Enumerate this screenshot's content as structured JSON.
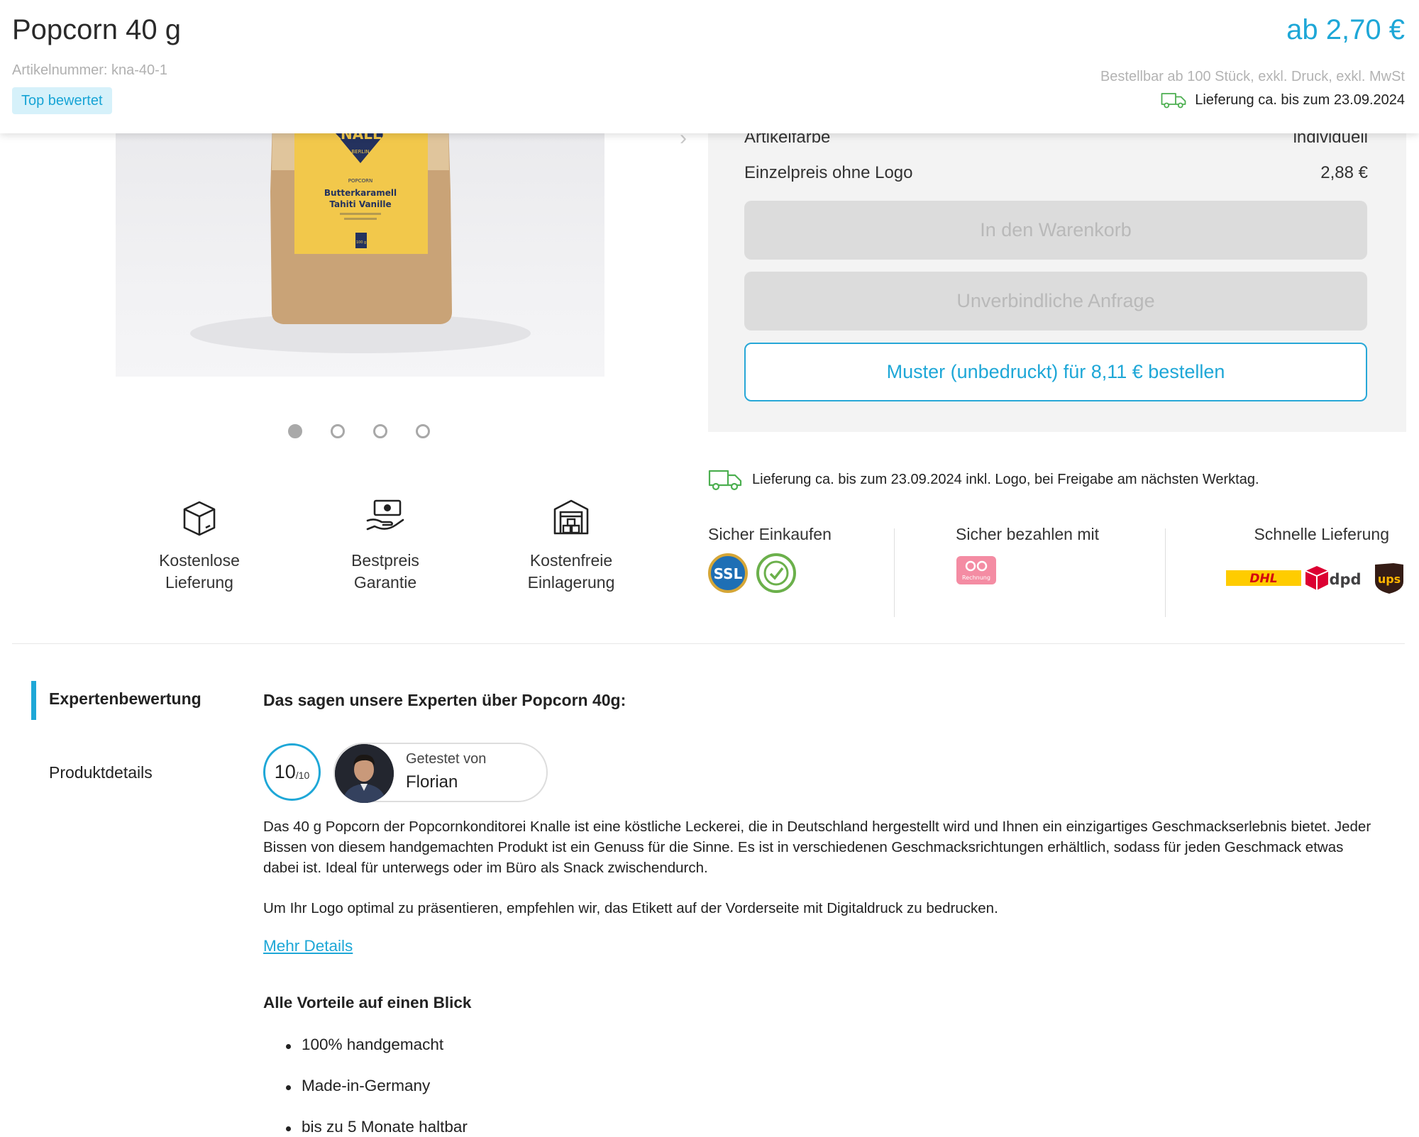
{
  "header": {
    "title": "Popcorn 40 g",
    "article_number": "Artikelnummer: kna-40-1",
    "badge": "Top bewertet",
    "price": "ab 2,70 €",
    "order_min": "Bestellbar ab 100 Stück, exkl. Druck, exkl. MwSt",
    "delivery": "Lieferung ca. bis zum 23.09.2024"
  },
  "product_image": {
    "brand": "KNALLE",
    "city": "BERLIN",
    "category": "POPCORN",
    "flavor_line1": "Butterkaramell",
    "flavor_line2": "Tahiti Vanille",
    "weight": "100 g"
  },
  "gallery": {
    "slide_count": 4,
    "active_index": 0
  },
  "features": [
    {
      "icon": "box-icon",
      "label": "Kostenlose\nLieferung"
    },
    {
      "icon": "money-hand-icon",
      "label": "Bestpreis\nGarantie"
    },
    {
      "icon": "warehouse-icon",
      "label": "Kostenfreie\nEinlagerung"
    }
  ],
  "panel": {
    "color_label": "Artikelfarbe",
    "color_value": "individuell",
    "unit_price_label": "Einzelpreis ohne Logo",
    "unit_price_value": "2,88 €",
    "cart_button": "In den Warenkorb",
    "inquiry_button": "Unverbindliche Anfrage",
    "sample_button": "Muster (unbedruckt) für 8,11 € bestellen"
  },
  "delivery_note": "Lieferung ca. bis zum 23.09.2024 inkl. Logo, bei Freigabe am nächsten Werktag.",
  "trust": {
    "shop_title": "Sicher Einkaufen",
    "ssl_text": "SSL",
    "pay_title": "Sicher bezahlen mit",
    "invoice_text": "Rechnung",
    "ship_title": "Schnelle Lieferung",
    "dhl": "DHL",
    "dpd": "dpd",
    "ups": "ups"
  },
  "tabs": {
    "expert": "Expertenbewertung",
    "details": "Produktdetails"
  },
  "review": {
    "heading": "Das sagen unsere Experten über Popcorn 40g:",
    "score": "10",
    "score_max": "/10",
    "tested_by": "Getestet von",
    "tester_name": "Florian"
  },
  "description": {
    "p1": "Das 40 g Popcorn der Popcornkonditorei Knalle ist eine köstliche Leckerei, die in Deutschland hergestellt wird und Ihnen ein einzigartiges Geschmackserlebnis bietet. Jeder Bissen von diesem handgemachten Produkt ist ein Genuss für die Sinne. Es ist in verschiedenen Geschmacksrichtungen erhältlich, sodass für jeden Geschmack etwas dabei ist. Ideal für unterwegs oder im Büro als Snack zwischendurch.",
    "p2": "Um Ihr Logo optimal zu präsentieren, empfehlen wir, das Etikett auf der Vorderseite mit Digitaldruck zu bedrucken.",
    "more_link": "Mehr Details"
  },
  "benefits": {
    "heading": "Alle Vorteile auf einen Blick",
    "items": [
      "100% handgemacht",
      "Made-in-Germany",
      "bis zu 5 Monate haltbar"
    ]
  },
  "colors": {
    "accent": "#1ea7d7",
    "badge_bg": "#d6f1fa",
    "panel_bg": "#f3f3f3",
    "disabled_btn": "#dcdcdc",
    "delivery_green": "#4caf50"
  }
}
